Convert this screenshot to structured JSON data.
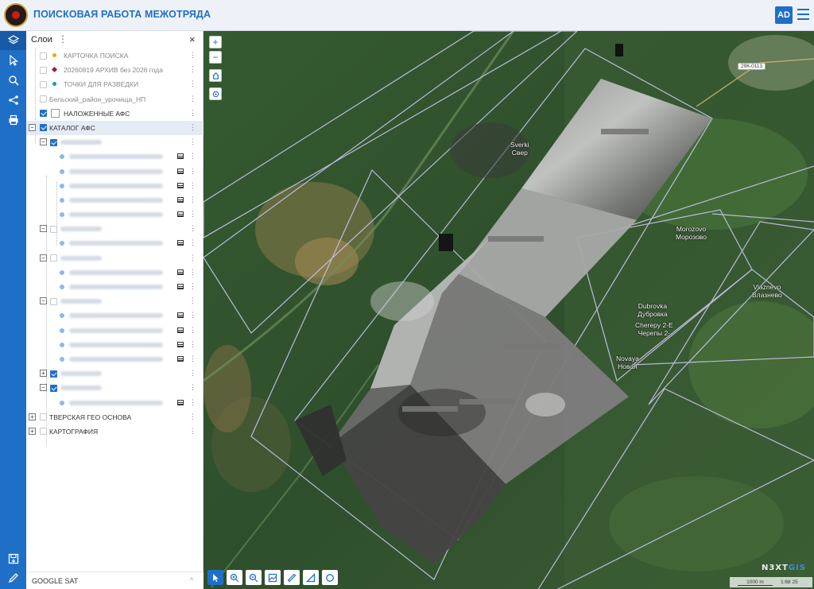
{
  "app": {
    "title": "ПОИСКОВАЯ РАБОТА МЕЖОТРЯДА",
    "user_initials": "AD"
  },
  "colors": {
    "brand": "#1f6fc7",
    "selected_row": "#e4ebf5"
  },
  "leftbar": {
    "icons": [
      "layers-icon",
      "cursor-icon",
      "search-icon",
      "share-icon",
      "print-icon",
      "save-icon",
      "edit-icon"
    ]
  },
  "panel": {
    "title": "Слои",
    "close": "×",
    "menu": "⋮",
    "layers": {
      "search_card": "КАРТОЧКА ПОИСКА",
      "archive": "20260819 АРХИВ без 2026 года",
      "recon_points": "ТОЧКИ ДЛЯ РАЗВЕДКИ",
      "belsky": "Бельский_район_урочища_НП",
      "overlaid_afs": "НАЛОЖЕННЫЕ АФС",
      "afs_catalog": "КАТАЛОГ АФС",
      "tver_geo": "ТВЕРСКАЯ ГЕО ОСНОВА",
      "cartography": "КАРТОГРАФИЯ"
    },
    "expand_plus": "+",
    "expand_minus": "−",
    "basemap": "GOOGLE SAT",
    "basemap_caret": "^"
  },
  "map": {
    "zoom_in": "+",
    "zoom_out": "−",
    "road_badge": "29К-0113",
    "places": {
      "sverki": "Sverki\nСвер",
      "morozovo": "Morozovo\nМорозово",
      "vlaznevo": "Vlaznevo\nВлазнево",
      "dubrovka": "Dubrovka\nДубровка",
      "cherepy": "Cherepy 2-E\nЧерепы 2-",
      "novaya": "Novaya\nНовая"
    },
    "brand_prefix": "N3XT",
    "brand_suffix": "GIS",
    "scale_label": "1000 m",
    "scale_ratio": "1:68 25"
  }
}
